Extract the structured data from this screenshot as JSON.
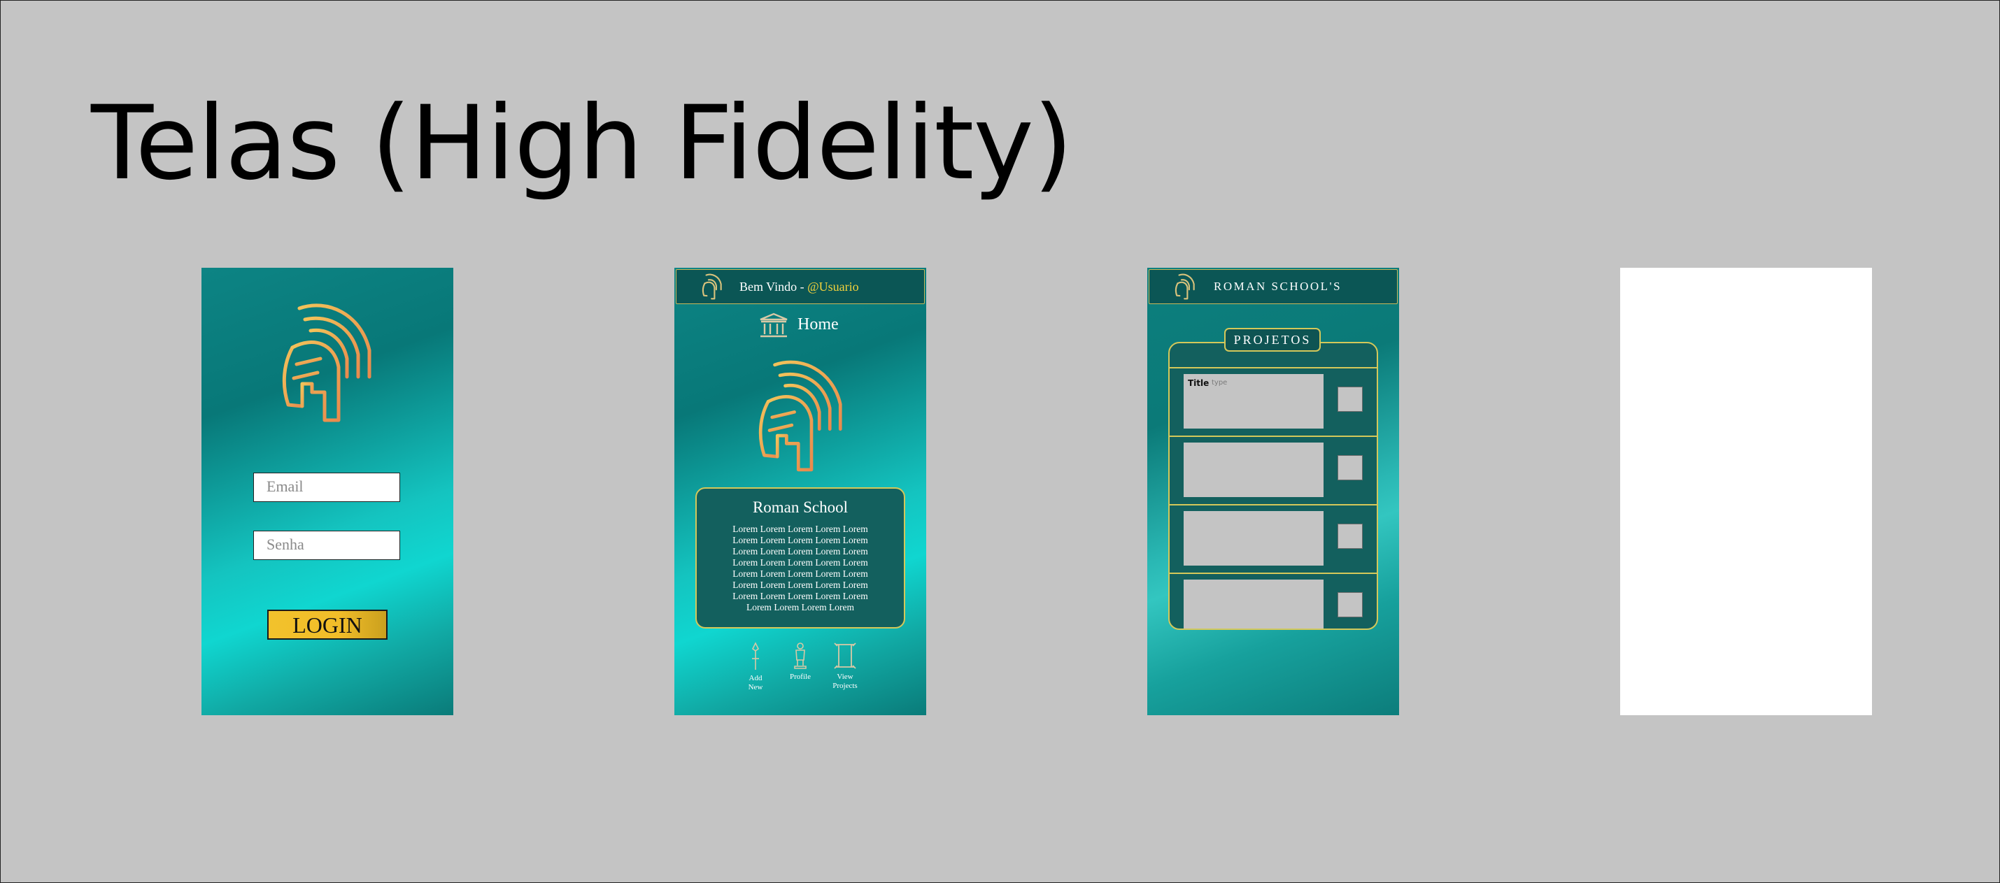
{
  "page": {
    "title": "Telas (High Fidelity)"
  },
  "colors": {
    "background": "#c4c4c4",
    "teal": "#0d8484",
    "gold": "#d4c85a",
    "accent": "#f3d23b"
  },
  "login": {
    "email_placeholder": "Email",
    "password_placeholder": "Senha",
    "button": "LOGIN"
  },
  "home": {
    "header_prefix": "Bem Vindo - ",
    "header_user": "@Usuario",
    "page_label": "Home",
    "card_title": "Roman School",
    "card_lines": [
      "Lorem Lorem Lorem Lorem Lorem",
      "Lorem Lorem Lorem Lorem Lorem",
      "Lorem Lorem Lorem Lorem Lorem",
      "Lorem Lorem Lorem Lorem Lorem",
      "Lorem Lorem Lorem Lorem Lorem",
      "Lorem Lorem Lorem Lorem Lorem",
      "Lorem Lorem Lorem Lorem Lorem",
      "Lorem Lorem Lorem Lorem"
    ],
    "nav": [
      {
        "label_1": "Add",
        "label_2": "New",
        "icon": "spear-icon"
      },
      {
        "label_1": "Profile",
        "label_2": "",
        "icon": "statue-icon"
      },
      {
        "label_1": "View",
        "label_2": "Projects",
        "icon": "scroll-icon"
      }
    ]
  },
  "projects": {
    "header_title": "ROMAN SCHOOL'S",
    "badge": "PROJETOS",
    "first_item": {
      "title": "Title",
      "type": "type"
    }
  }
}
